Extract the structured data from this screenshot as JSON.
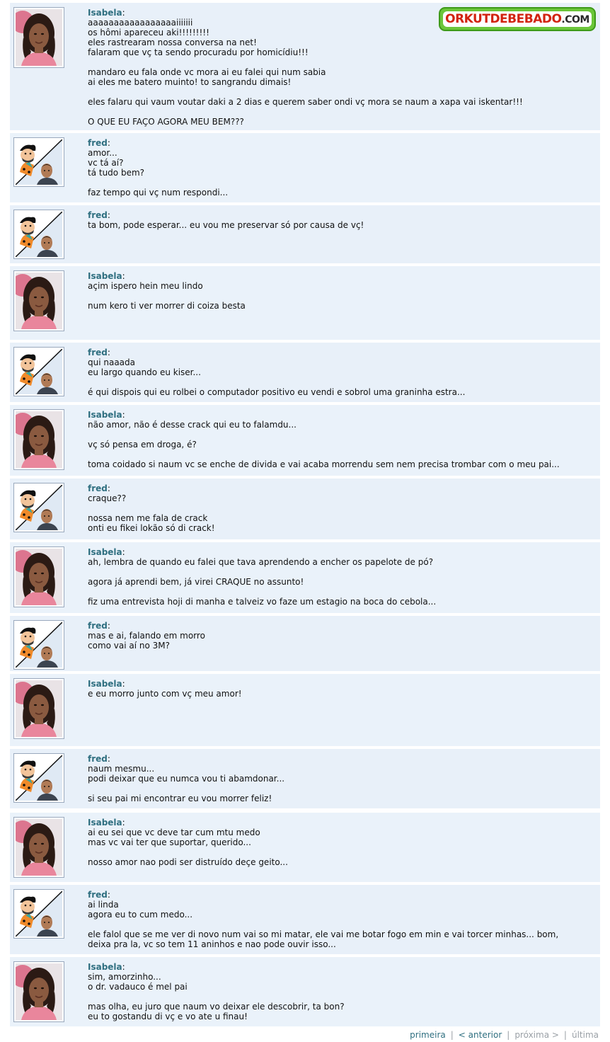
{
  "logo": {
    "brand": "ORKUTDEBEBADO",
    "domain": ".COM"
  },
  "scraps": [
    {
      "author": "Isabela",
      "avatar": "isabela",
      "lines": [
        "aaaaaaaaaaaaaaaaaiiiiiii",
        "os hômi apareceu aki!!!!!!!!!",
        "eles rastrearam nossa conversa na net!",
        "falaram que vç ta sendo procuradu por homicídiu!!!",
        "",
        "mandaro eu fala onde vc mora ai eu falei qui num sabia",
        "ai eles me batero muinto! to sangrandu dimais!",
        "",
        "eles falaru qui vaum voutar daki a 2 dias e querem saber ondi vç mora se naum a xapa vai iskentar!!!",
        "",
        "O QUE EU FAÇO AGORA MEU BEM???"
      ]
    },
    {
      "author": "fred",
      "avatar": "fred",
      "lines": [
        "amor...",
        "vc tá aí?",
        "tá tudo bem?",
        "",
        "faz tempo qui vç num respondi..."
      ]
    },
    {
      "author": "fred",
      "avatar": "fred",
      "lines": [
        "ta bom, pode esperar... eu vou me preservar só por causa de vç!"
      ]
    },
    {
      "author": "Isabela",
      "avatar": "isabela",
      "lines": [
        "açim ispero hein meu lindo",
        "",
        "num kero ti ver morrer di coiza besta"
      ]
    },
    {
      "author": "fred",
      "avatar": "fred",
      "lines": [
        "qui naaada",
        "eu largo quando eu kiser...",
        "",
        "é qui dispois qui eu rolbei o computador positivo eu vendi e sobrol uma graninha estra..."
      ]
    },
    {
      "author": "Isabela",
      "avatar": "isabela",
      "lines": [
        "não amor, não é desse crack qui eu to falamdu...",
        "",
        "vç só pensa em droga, é?",
        "",
        "toma coidado si naum vc se enche de divida e vai acaba morrendu sem nem precisa trombar com o meu pai..."
      ]
    },
    {
      "author": "fred",
      "avatar": "fred",
      "lines": [
        "craque??",
        "",
        "nossa nem me fala de crack",
        "onti eu fikei lokão só di crack!"
      ]
    },
    {
      "author": "Isabela",
      "avatar": "isabela",
      "lines": [
        "ah, lembra de quando eu falei que tava aprendendo a encher os papelote de pó?",
        "",
        "agora já aprendi bem, já virei CRAQUE no assunto!",
        "",
        "fiz uma entrevista hoji di manha e talveiz vo faze um estagio na boca do cebola..."
      ]
    },
    {
      "author": "fred",
      "avatar": "fred",
      "lines": [
        "mas e ai, falando em morro",
        "como vai aí no 3M?"
      ]
    },
    {
      "author": "Isabela",
      "avatar": "isabela",
      "lines": [
        "e eu morro junto com vç meu amor!"
      ]
    },
    {
      "author": "fred",
      "avatar": "fred",
      "lines": [
        "naum mesmu...",
        "podi deixar que eu numca vou ti abamdonar...",
        "",
        "si seu pai mi encontrar eu vou morrer feliz!"
      ]
    },
    {
      "author": "Isabela",
      "avatar": "isabela",
      "lines": [
        "ai eu sei que vc deve tar cum mtu medo",
        "mas vc vai ter que suportar, querido...",
        "",
        "nosso amor nao podi ser distruído deçe geito..."
      ]
    },
    {
      "author": "fred",
      "avatar": "fred",
      "lines": [
        "ai linda",
        "agora eu to cum medo...",
        "",
        "ele falol que se me ver di novo num vai so mi matar, ele vai me botar fogo em min e vai torcer minhas... bom,",
        "deixa pra la, vc so tem 11 aninhos e nao pode ouvir isso..."
      ]
    },
    {
      "author": "Isabela",
      "avatar": "isabela",
      "lines": [
        "sim, amorzinho...",
        "o dr. vadauco é mel pai",
        "",
        "mas olha, eu juro que naum vo deixar ele descobrir, ta bon?",
        "eu to gostandu di vç e vo ate u finau!"
      ]
    }
  ],
  "pager": {
    "first": "primeira",
    "prev": "< anterior",
    "next": "próxima >",
    "last": "última"
  }
}
